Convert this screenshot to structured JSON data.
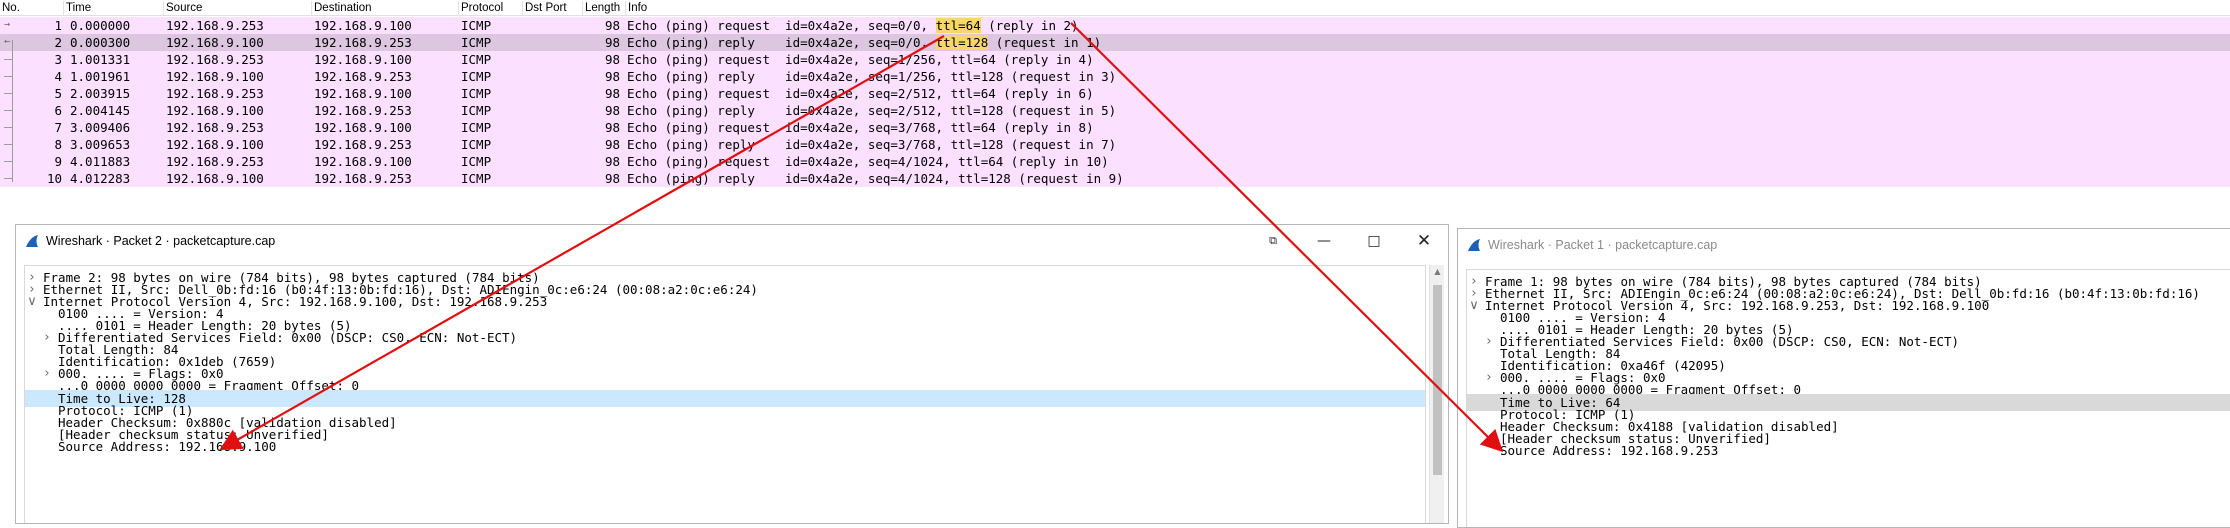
{
  "columns": [
    "No.",
    "Time",
    "Source",
    "Destination",
    "Protocol",
    "Dst Port",
    "Length",
    "Info"
  ],
  "packets": [
    {
      "no": "1",
      "time": "0.000000",
      "src": "192.168.9.253",
      "dst": "192.168.9.100",
      "proto": "ICMP",
      "len": "98",
      "info_pre": "Echo (ping) request  id=0x4a2e, seq=0/0, ",
      "info_ttl": "ttl=64",
      "info_post": " (reply in 2)"
    },
    {
      "no": "2",
      "time": "0.000300",
      "src": "192.168.9.100",
      "dst": "192.168.9.253",
      "proto": "ICMP",
      "len": "98",
      "info_pre": "Echo (ping) reply    id=0x4a2e, seq=0/0, ",
      "info_ttl": "ttl=128",
      "info_post": " (request in 1)"
    },
    {
      "no": "3",
      "time": "1.001331",
      "src": "192.168.9.253",
      "dst": "192.168.9.100",
      "proto": "ICMP",
      "len": "98",
      "info_pre": "Echo (ping) request  id=0x4a2e, seq=1/256, ttl=64 (reply in 4)",
      "info_ttl": "",
      "info_post": ""
    },
    {
      "no": "4",
      "time": "1.001961",
      "src": "192.168.9.100",
      "dst": "192.168.9.253",
      "proto": "ICMP",
      "len": "98",
      "info_pre": "Echo (ping) reply    id=0x4a2e, seq=1/256, ttl=128 (request in 3)",
      "info_ttl": "",
      "info_post": ""
    },
    {
      "no": "5",
      "time": "2.003915",
      "src": "192.168.9.253",
      "dst": "192.168.9.100",
      "proto": "ICMP",
      "len": "98",
      "info_pre": "Echo (ping) request  id=0x4a2e, seq=2/512, ttl=64 (reply in 6)",
      "info_ttl": "",
      "info_post": ""
    },
    {
      "no": "6",
      "time": "2.004145",
      "src": "192.168.9.100",
      "dst": "192.168.9.253",
      "proto": "ICMP",
      "len": "98",
      "info_pre": "Echo (ping) reply    id=0x4a2e, seq=2/512, ttl=128 (request in 5)",
      "info_ttl": "",
      "info_post": ""
    },
    {
      "no": "7",
      "time": "3.009406",
      "src": "192.168.9.253",
      "dst": "192.168.9.100",
      "proto": "ICMP",
      "len": "98",
      "info_pre": "Echo (ping) request  id=0x4a2e, seq=3/768, ttl=64 (reply in 8)",
      "info_ttl": "",
      "info_post": ""
    },
    {
      "no": "8",
      "time": "3.009653",
      "src": "192.168.9.100",
      "dst": "192.168.9.253",
      "proto": "ICMP",
      "len": "98",
      "info_pre": "Echo (ping) reply    id=0x4a2e, seq=3/768, ttl=128 (request in 7)",
      "info_ttl": "",
      "info_post": ""
    },
    {
      "no": "9",
      "time": "4.011883",
      "src": "192.168.9.253",
      "dst": "192.168.9.100",
      "proto": "ICMP",
      "len": "98",
      "info_pre": "Echo (ping) request  id=0x4a2e, seq=4/1024, ttl=64 (reply in 10)",
      "info_ttl": "",
      "info_post": ""
    },
    {
      "no": "10",
      "time": "4.012283",
      "src": "192.168.9.100",
      "dst": "192.168.9.253",
      "proto": "ICMP",
      "len": "98",
      "info_pre": "Echo (ping) reply    id=0x4a2e, seq=4/1024, ttl=128 (request in 9)",
      "info_ttl": "",
      "info_post": ""
    }
  ],
  "window2": {
    "title": "Wireshark · Packet 2 · packetcapture.cap",
    "rows": [
      {
        "t": "Frame 2: 98 bytes on wire (784 bits), 98 bytes captured (784 bits)"
      },
      {
        "t": "Ethernet II, Src: Dell_0b:fd:16 (b0:4f:13:0b:fd:16), Dst: ADIEngin_0c:e6:24 (00:08:a2:0c:e6:24)"
      },
      {
        "t": "Internet Protocol Version 4, Src: 192.168.9.100, Dst: 192.168.9.253"
      },
      {
        "t": "0100 .... = Version: 4"
      },
      {
        "t": ".... 0101 = Header Length: 20 bytes (5)"
      },
      {
        "t": "Differentiated Services Field: 0x00 (DSCP: CS0, ECN: Not-ECT)"
      },
      {
        "t": "Total Length: 84"
      },
      {
        "t": "Identification: 0x1deb (7659)"
      },
      {
        "t": "000. .... = Flags: 0x0"
      },
      {
        "t": "...0 0000 0000 0000 = Fragment Offset: 0"
      },
      {
        "t": "Time to Live: 128"
      },
      {
        "t": "Protocol: ICMP (1)"
      },
      {
        "t": "Header Checksum: 0x880c [validation disabled]"
      },
      {
        "t": "[Header checksum status: Unverified]"
      },
      {
        "t": "Source Address: 192.168.9.100"
      }
    ]
  },
  "window1": {
    "title": "Wireshark · Packet 1 · packetcapture.cap",
    "rows": [
      {
        "t": "Frame 1: 98 bytes on wire (784 bits), 98 bytes captured (784 bits)"
      },
      {
        "t": "Ethernet II, Src: ADIEngin_0c:e6:24 (00:08:a2:0c:e6:24), Dst: Dell_0b:fd:16 (b0:4f:13:0b:fd:16)"
      },
      {
        "t": "Internet Protocol Version 4, Src: 192.168.9.253, Dst: 192.168.9.100"
      },
      {
        "t": "0100 .... = Version: 4"
      },
      {
        "t": ".... 0101 = Header Length: 20 bytes (5)"
      },
      {
        "t": "Differentiated Services Field: 0x00 (DSCP: CS0, ECN: Not-ECT)"
      },
      {
        "t": "Total Length: 84"
      },
      {
        "t": "Identification: 0xa46f (42095)"
      },
      {
        "t": "000. .... = Flags: 0x0"
      },
      {
        "t": "...0 0000 0000 0000 = Fragment Offset: 0"
      },
      {
        "t": "Time to Live: 64"
      },
      {
        "t": "Protocol: ICMP (1)"
      },
      {
        "t": "Header Checksum: 0x4188 [validation disabled]"
      },
      {
        "t": "[Header checksum status: Unverified]"
      },
      {
        "t": "Source Address: 192.168.9.253"
      }
    ]
  },
  "colors": {
    "row_bg": "#fce0ff",
    "row_selected": "#dcc6e0",
    "ttl_highlight": "#f7d66b",
    "detail_selected": "#cce8ff",
    "annotation_arrow": "#e01010",
    "shark_fin": "#1f5fb4"
  },
  "icons": {
    "window_icon": "shark-fin-icon",
    "restore": "restore-window-icon",
    "minimize": "minimize-icon",
    "maximize": "maximize-icon",
    "close": "close-icon"
  }
}
